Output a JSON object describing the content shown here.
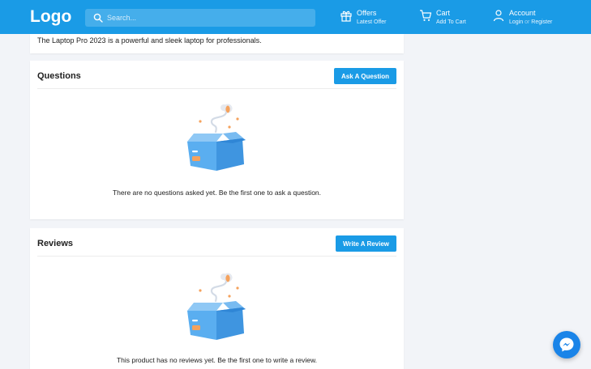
{
  "header": {
    "logo": "Logo",
    "search_placeholder": "Search...",
    "nav": {
      "offers": {
        "label": "Offers",
        "sub": "Latest Offer"
      },
      "cart": {
        "label": "Cart",
        "sub": "Add To Cart"
      },
      "account": {
        "label": "Account",
        "login": "Login",
        "separator": "or",
        "register": "Register"
      }
    }
  },
  "description": {
    "text": "The Laptop Pro 2023 is a powerful and sleek laptop for professionals."
  },
  "questions": {
    "title": "Questions",
    "button": "Ask A Question",
    "empty": "There are no questions asked yet. Be the first one to ask a question."
  },
  "reviews": {
    "title": "Reviews",
    "button": "Write A Review",
    "empty": "This product has no reviews yet. Be the first one to write a review."
  },
  "colors": {
    "primary": "#1a9be6",
    "background": "#f2f4f8",
    "box_blue": "#5aaef0",
    "accent_orange": "#f5a25d"
  },
  "icons": [
    "search-icon",
    "gift-icon",
    "cart-icon",
    "user-icon",
    "empty-box-icon",
    "messenger-icon"
  ]
}
